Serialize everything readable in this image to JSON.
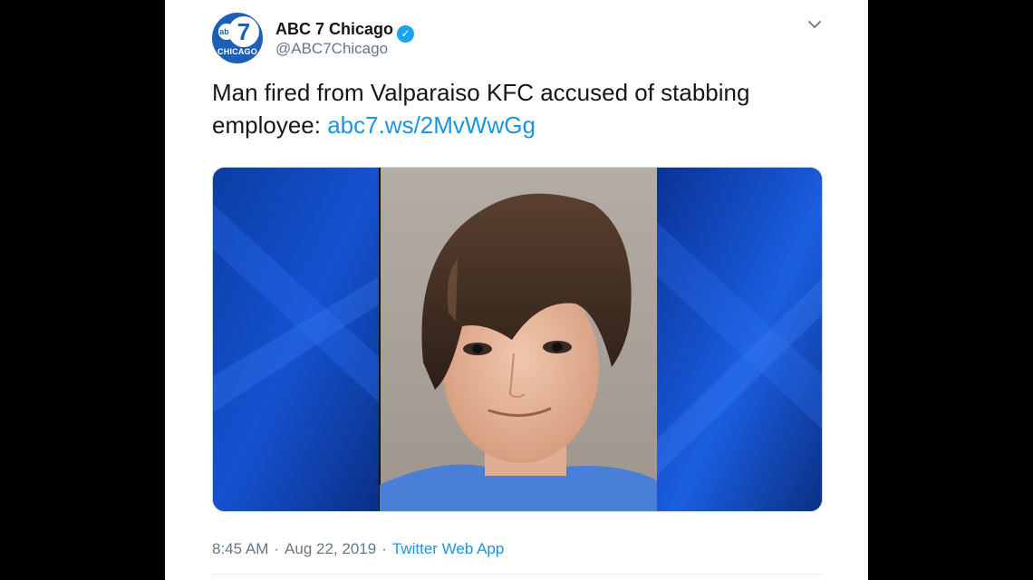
{
  "author": {
    "display_name": "ABC 7 Chicago",
    "handle": "@ABC7Chicago",
    "verified": true,
    "avatar": {
      "logo_small": "abc",
      "logo_number": "7",
      "logo_city": "CHICAGO"
    }
  },
  "tweet": {
    "text": "Man fired from Valparaiso KFC accused of stabbing employee: ",
    "link_text": "abc7.ws/2MvWwGg"
  },
  "media": {
    "description_icon": "mugshot-photo"
  },
  "meta": {
    "time": "8:45 AM",
    "separator": "·",
    "date": "Aug 22, 2019",
    "source": "Twitter Web App"
  },
  "icons": {
    "menu": "chevron-down-icon",
    "verified": "verified-badge-icon"
  },
  "colors": {
    "link": "#1b95e0",
    "brand_blue": "#1d5fb5",
    "verified": "#1da1f2",
    "muted": "#657786",
    "text": "#14171a"
  }
}
